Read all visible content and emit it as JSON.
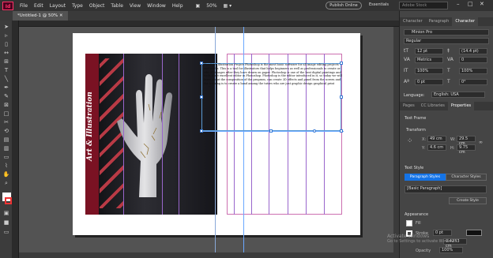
{
  "app": {
    "logo": "Id"
  },
  "menu": [
    "File",
    "Edit",
    "Layout",
    "Type",
    "Object",
    "Table",
    "View",
    "Window",
    "Help"
  ],
  "toolbar_top": {
    "zoom": "50%",
    "publish": "Publish Online",
    "workspace": "Essentials",
    "search_placeholder": "Adobe Stock"
  },
  "document_tab": "*Untitled-1 @ 50%",
  "cover": {
    "title": "Art & Illustration"
  },
  "body_text": "Hand Art Illustration Project Photoshop is the most basic software for all image editing projects and works. This is a tool for illustrators that helps beginners as well as professionals to create or edit 3D images after they have drawn on paper. Photoshop is one of the best digital paintings and tools if not excellent editor in Photoshop. Photoshop is the editor introduced in it, so today we will learn about the composition of the program, can create 3D effects and panel from the screen and the training is to create a hand among the tutors who are just graphic design graphical print media.",
  "panel": {
    "tabs_top": [
      "Character",
      "Paragraph",
      "Character"
    ],
    "font": "Minion Pro",
    "style": "Regular",
    "size": "12 pt",
    "leading": "(14.4 pt)",
    "kerning": "Metrics",
    "tracking": "0",
    "vscale": "100%",
    "hscale": "100%",
    "baseline": "0 pt",
    "skew": "0°",
    "language_label": "Language:",
    "language": "English: USA",
    "tabs_mid": [
      "Pages",
      "CC Libraries",
      "Properties"
    ],
    "text_frame": "Text Frame",
    "transform": "Transform",
    "x_label": "X:",
    "x": "49 cm",
    "w_label": "W:",
    "w": "29.5 cm",
    "y_label": "Y:",
    "y": "4.6 cm",
    "h_label": "H:",
    "h": "9.75 cm",
    "text_style": "Text Style",
    "para_styles": "Paragraph Styles",
    "char_styles": "Character Styles",
    "basic_para": "[Basic Paragraph]",
    "create_style": "Create Style",
    "appearance": "Appearance",
    "fill": "Fill",
    "stroke": "Stroke",
    "stroke_weight": "0 pt",
    "stroke_weight2": "0.4233 cm",
    "opacity": "Opacity",
    "opacity_value": "100%"
  },
  "watermark": {
    "line1": "Activate Windows",
    "line2": "Go to Settings to activate Windows."
  },
  "colors": {
    "menubar": "#323232",
    "panel": "#454545",
    "accent": "#1473e6",
    "cover_red": "#7a1223"
  }
}
